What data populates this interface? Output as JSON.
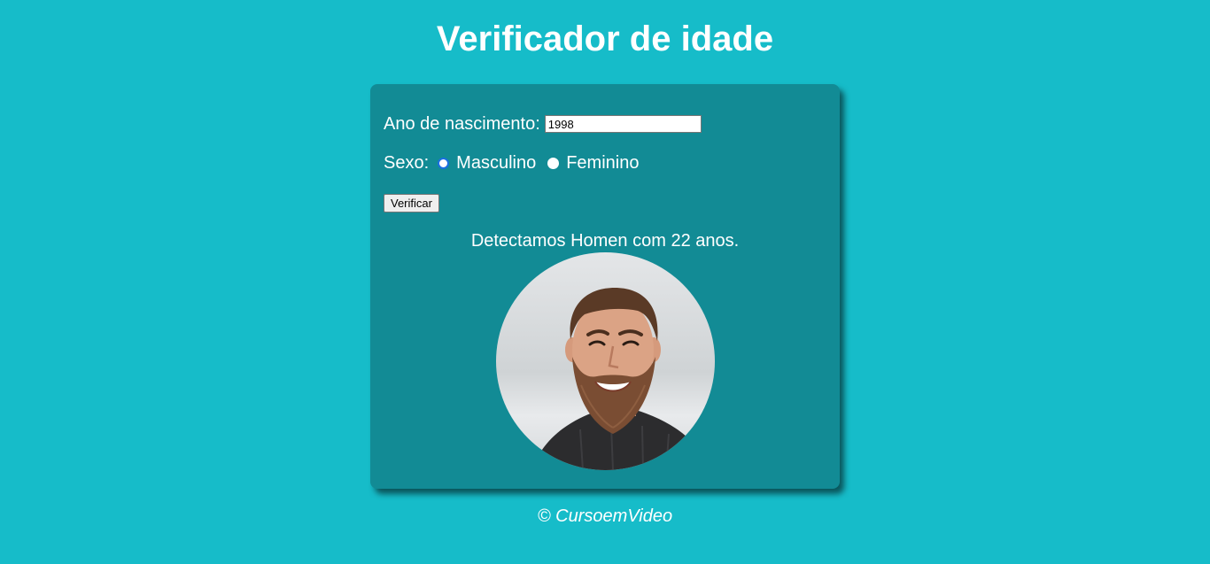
{
  "header": {
    "title": "Verificador de idade"
  },
  "form": {
    "birth_year_label": "Ano de nascimento:",
    "birth_year_value": "1998",
    "sex_label": "Sexo:",
    "sex_options": [
      {
        "label": "Masculino",
        "selected": true
      },
      {
        "label": "Feminino",
        "selected": false
      }
    ],
    "verify_button_label": "Verificar"
  },
  "result": {
    "text": "Detectamos Homen com 22 anos.",
    "photo": "bearded-man-portrait"
  },
  "footer": {
    "text": "© CursoemVideo"
  },
  "colors": {
    "background": "#16bcc9",
    "card": "#128b95",
    "text": "#ffffff",
    "radio_accent": "#1a6fe0"
  }
}
